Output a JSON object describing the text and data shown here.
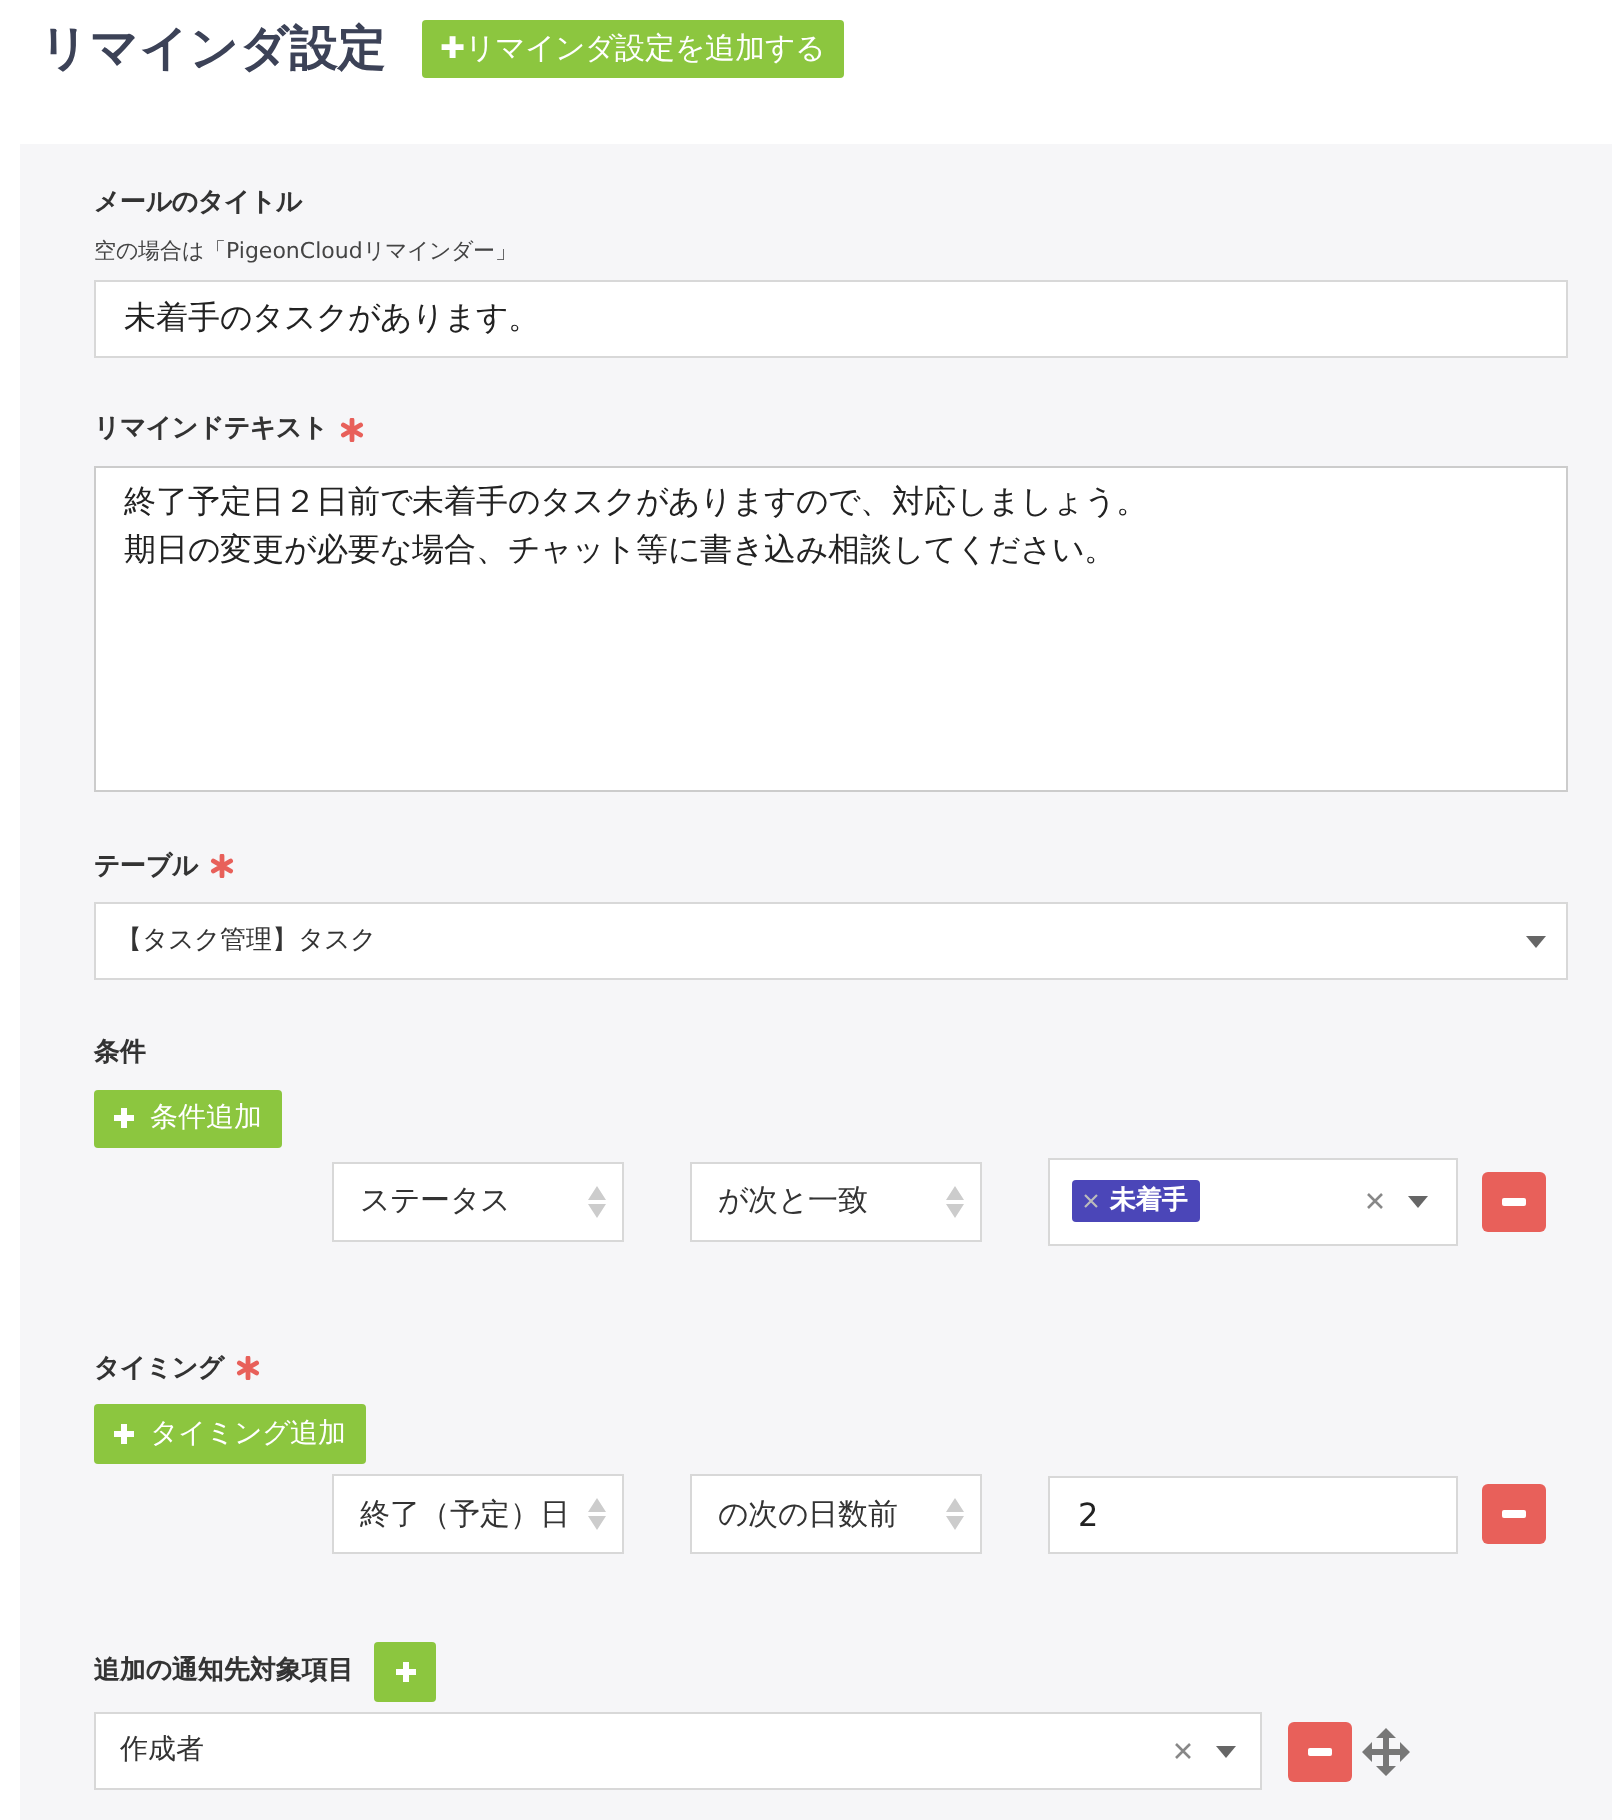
{
  "header": {
    "title": "リマインダ設定",
    "add_button": "✚リマインダ設定を追加する"
  },
  "mail_title": {
    "label": "メールのタイトル",
    "hint": "空の場合は「PigeonCloudリマインダー」",
    "value": "未着手のタスクがあります。"
  },
  "remind_text": {
    "label": "リマインドテキスト",
    "required": true,
    "lines": [
      "終了予定日２日前で未着手のタスクがありますので、対応しましょう。",
      "期日の変更が必要な場合、チャット等に書き込み相談してください。"
    ]
  },
  "table": {
    "label": "テーブル",
    "required": true,
    "value": "【タスク管理】タスク"
  },
  "conditions": {
    "label": "条件",
    "required": false,
    "add_button": "条件追加",
    "rows": [
      {
        "field": "ステータス",
        "operator": "が次と一致",
        "tags": [
          "未着手"
        ]
      }
    ]
  },
  "timing": {
    "label": "タイミング",
    "required": true,
    "add_button": "タイミング追加",
    "rows": [
      {
        "field": "終了（予定）日",
        "operator": "の次の日数前",
        "value": "2"
      }
    ]
  },
  "notify": {
    "label": "追加の通知先対象項目",
    "items": [
      {
        "value": "作成者"
      }
    ]
  }
}
